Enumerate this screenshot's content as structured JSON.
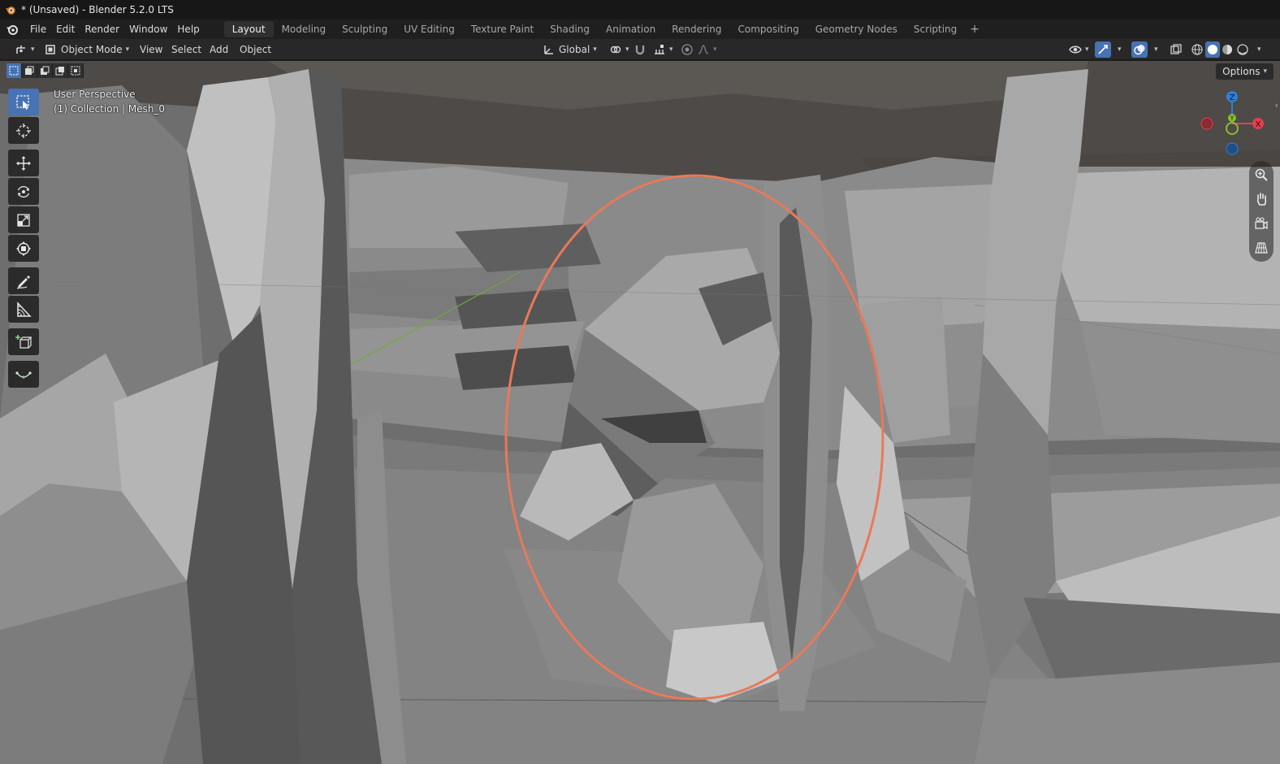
{
  "window": {
    "title": "* (Unsaved) - Blender 5.2.0 LTS"
  },
  "menu": [
    "File",
    "Edit",
    "Render",
    "Window",
    "Help"
  ],
  "workspaces": [
    "Layout",
    "Modeling",
    "Sculpting",
    "UV Editing",
    "Texture Paint",
    "Shading",
    "Animation",
    "Rendering",
    "Compositing",
    "Geometry Nodes",
    "Scripting"
  ],
  "active_workspace": "Layout",
  "workspace_add": "+",
  "viewport_header": {
    "mode": "Object Mode",
    "menus": [
      "View",
      "Select",
      "Add",
      "Object"
    ],
    "orientation": "Global"
  },
  "viewport": {
    "perspective_label": "User Perspective",
    "collection_label": "(1) Collection | Mesh_0",
    "options_label": "Options",
    "annotation_color": "#e8795a",
    "gizmo": {
      "z": "Z",
      "y": "Y",
      "x": "X",
      "x_color": "#e53e4e",
      "y_color": "#86bf2d",
      "z_color": "#2f80d6"
    }
  },
  "colors": {
    "accent": "#4772b3",
    "annotation": "#e8795a"
  }
}
